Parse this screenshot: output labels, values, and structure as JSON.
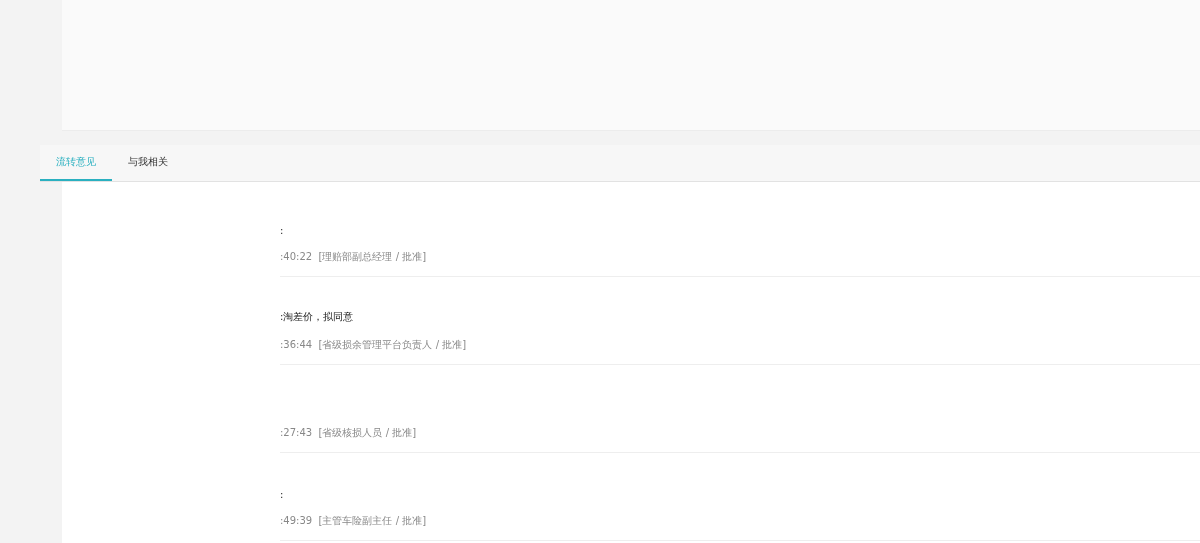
{
  "tabs": [
    {
      "label": "流转意见",
      "selected": true
    },
    {
      "label": "与我相关",
      "selected": false
    }
  ],
  "entries": [
    {
      "comment": ":",
      "meta": ":40:22  [理赔部副总经理 / 批准]"
    },
    {
      "comment": ":淘差价，拟同意",
      "meta": ":36:44  [省级损余管理平台负责人 / 批准]"
    },
    {
      "meta": ":27:43  [省级核损人员 / 批准]"
    },
    {
      "comment": ":",
      "meta": ":49:39  [主管车险副主任 / 批准]"
    }
  ]
}
